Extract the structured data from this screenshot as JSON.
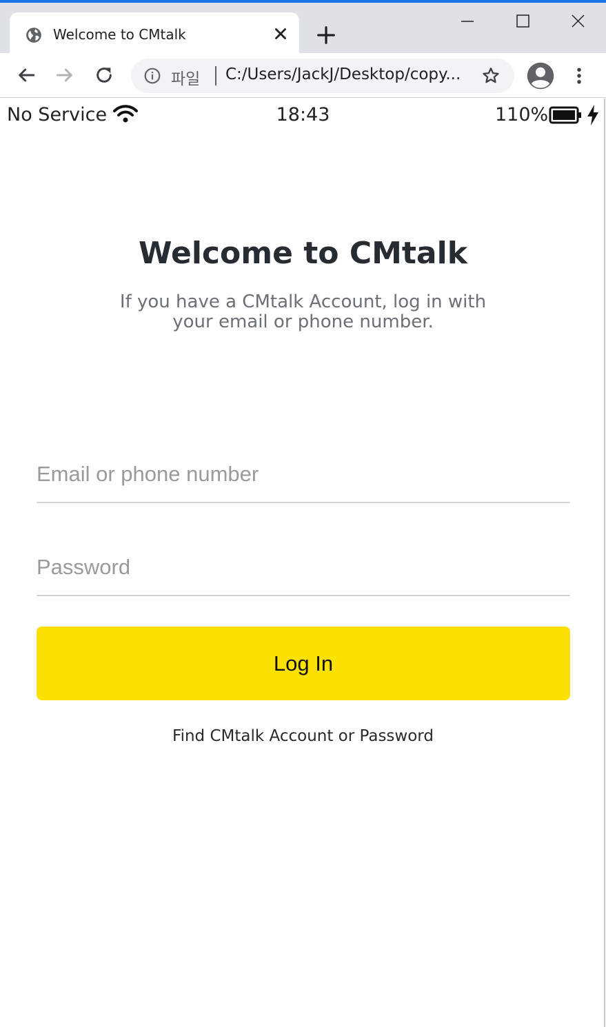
{
  "browser": {
    "tab_title": "Welcome to CMtalk",
    "tab_icon": "globe-icon",
    "new_tab_icon": "plus-icon",
    "scheme_label": "파일",
    "url": "C:/Users/JackJ/Desktop/copy...",
    "accent_color": "#1a73e8"
  },
  "status_bar": {
    "carrier": "No Service",
    "time": "18:43",
    "battery_percent": "110%"
  },
  "login": {
    "heading": "Welcome to CMtalk",
    "subtitle": "If you have a CMtalk Account, log in with your email or phone number.",
    "email_placeholder": "Email or phone number",
    "password_placeholder": "Password",
    "login_button": "Log In",
    "find_link": "Find CMtalk Account or Password",
    "button_color": "#fae100"
  }
}
